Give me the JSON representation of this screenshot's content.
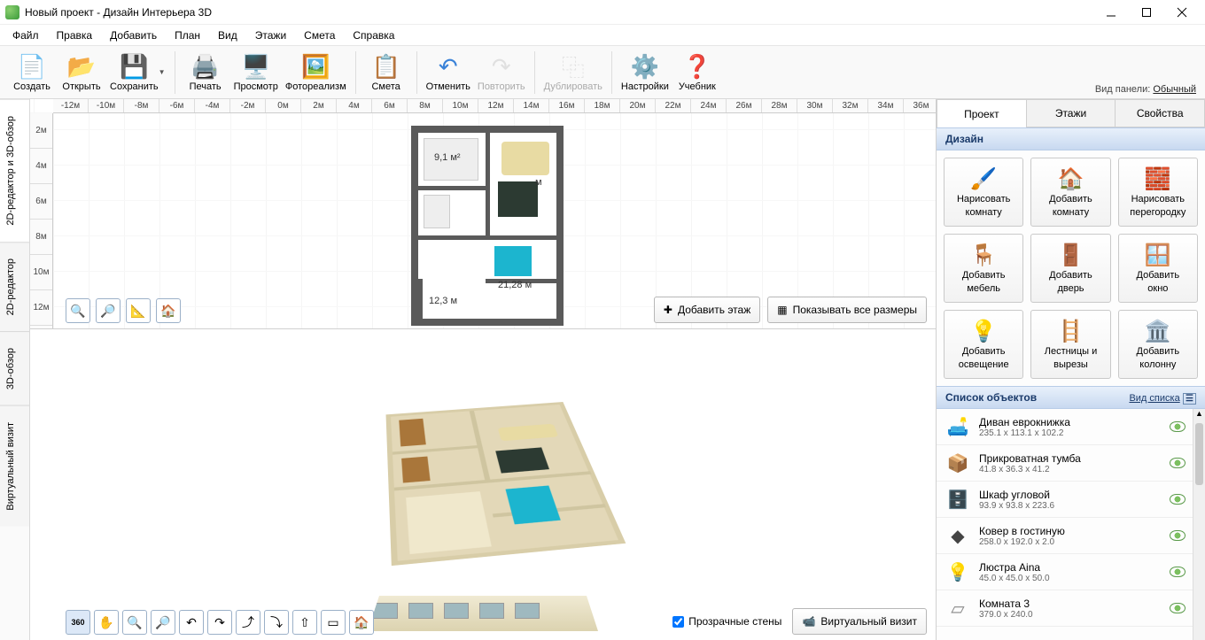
{
  "titlebar": {
    "title": "Новый проект - Дизайн Интерьера 3D"
  },
  "menu": [
    "Файл",
    "Правка",
    "Добавить",
    "План",
    "Вид",
    "Этажи",
    "Смета",
    "Справка"
  ],
  "toolbar": [
    {
      "id": "create",
      "label": "Создать"
    },
    {
      "id": "open",
      "label": "Открыть"
    },
    {
      "id": "save",
      "label": "Сохранить"
    },
    {
      "sep": true
    },
    {
      "id": "print",
      "label": "Печать"
    },
    {
      "id": "preview",
      "label": "Просмотр"
    },
    {
      "id": "photoreal",
      "label": "Фотореализм"
    },
    {
      "sep": true
    },
    {
      "id": "estimate",
      "label": "Смета"
    },
    {
      "sep": true
    },
    {
      "id": "undo",
      "label": "Отменить"
    },
    {
      "id": "redo",
      "label": "Повторить",
      "dim": true
    },
    {
      "sep": true
    },
    {
      "id": "duplicate",
      "label": "Дублировать",
      "dim": true
    },
    {
      "sep": true
    },
    {
      "id": "settings",
      "label": "Настройки"
    },
    {
      "id": "tutorial",
      "label": "Учебник"
    }
  ],
  "panel_view": {
    "label": "Вид панели:",
    "value": "Обычный"
  },
  "vtabs": [
    "2D-редактор и 3D-обзор",
    "2D-редактор",
    "3D-обзор",
    "Виртуальный визит"
  ],
  "ruler_h": [
    "-12м",
    "-10м",
    "-8м",
    "-6м",
    "-4м",
    "-2м",
    "0м",
    "2м",
    "4м",
    "6м",
    "8м",
    "10м",
    "12м",
    "14м",
    "16м",
    "18м",
    "20м",
    "22м",
    "24м",
    "26м",
    "28м",
    "30м",
    "32м",
    "34м",
    "36м"
  ],
  "ruler_v": [
    "2м",
    "4м",
    "6м",
    "8м",
    "10м",
    "12м"
  ],
  "plan_labels": {
    "a": "9,1 м²",
    "b": "12,3 м",
    "c": "21,28 м",
    "d": "м"
  },
  "view_btns": {
    "add_floor": "Добавить этаж",
    "show_dims": "Показывать все размеры"
  },
  "view3d": {
    "transparent": "Прозрачные стены",
    "vv": "Виртуальный визит"
  },
  "rtabs": [
    "Проект",
    "Этажи",
    "Свойства"
  ],
  "design_hdr": "Дизайн",
  "design_btns": [
    {
      "l1": "Нарисовать",
      "l2": "комнату"
    },
    {
      "l1": "Добавить",
      "l2": "комнату"
    },
    {
      "l1": "Нарисовать",
      "l2": "перегородку"
    },
    {
      "l1": "Добавить",
      "l2": "мебель"
    },
    {
      "l1": "Добавить",
      "l2": "дверь"
    },
    {
      "l1": "Добавить",
      "l2": "окно"
    },
    {
      "l1": "Добавить",
      "l2": "освещение"
    },
    {
      "l1": "Лестницы и",
      "l2": "вырезы"
    },
    {
      "l1": "Добавить",
      "l2": "колонну"
    }
  ],
  "obj_hdr": "Список объектов",
  "obj_view": "Вид списка",
  "objects": [
    {
      "name": "Диван еврокнижка",
      "size": "235.1 x 113.1 x 102.2"
    },
    {
      "name": "Прикроватная тумба",
      "size": "41.8 x 36.3 x 41.2"
    },
    {
      "name": "Шкаф угловой",
      "size": "93.9 x 93.8 x 223.6"
    },
    {
      "name": "Ковер в гостиную",
      "size": "258.0 x 192.0 x 2.0"
    },
    {
      "name": "Люстра Aina",
      "size": "45.0 x 45.0 x 50.0"
    },
    {
      "name": "Комната 3",
      "size": "379.0 x 240.0"
    }
  ]
}
